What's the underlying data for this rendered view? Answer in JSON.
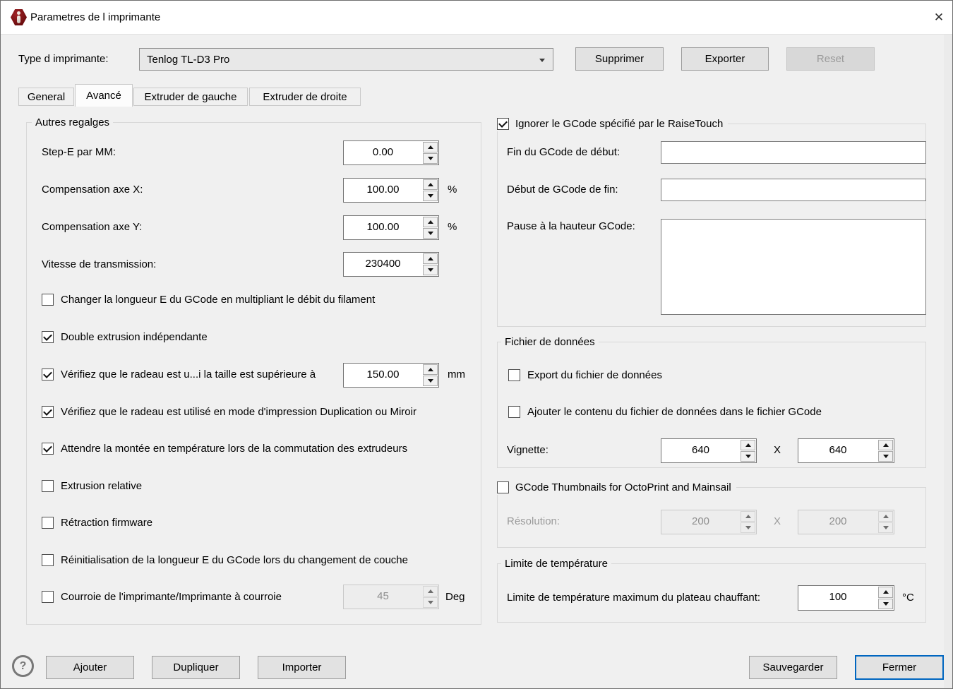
{
  "window": {
    "title": "Parametres de l imprimante"
  },
  "icons": {
    "close": "✕",
    "help": "?"
  },
  "header": {
    "printer_type_label": "Type d imprimante:",
    "printer_type_value": "Tenlog TL-D3 Pro",
    "supprimer": "Supprimer",
    "exporter": "Exporter",
    "reset": "Reset"
  },
  "tabs": [
    {
      "label": "General",
      "active": false
    },
    {
      "label": "Avancé",
      "active": true
    },
    {
      "label": "Extruder de gauche",
      "active": false
    },
    {
      "label": "Extruder de droite",
      "active": false
    }
  ],
  "left_panel": {
    "group_title": "Autres regalges",
    "fields": [
      {
        "label": "Step-E par MM:",
        "value": "0.00",
        "unit": ""
      },
      {
        "label": "Compensation axe X:",
        "value": "100.00",
        "unit": "%"
      },
      {
        "label": "Compensation axe Y:",
        "value": "100.00",
        "unit": "%"
      },
      {
        "label": "Vitesse de transmission:",
        "value": "230400",
        "unit": ""
      }
    ],
    "checkboxes": [
      {
        "label": "Changer la longueur E du GCode en multipliant le débit du filament",
        "checked": false
      },
      {
        "label": "Double extrusion indépendante",
        "checked": true
      },
      {
        "label": "Vérifiez que le radeau est u...i la taille est supérieure à",
        "checked": true,
        "value": "150.00",
        "unit": "mm"
      },
      {
        "label": "Vérifiez que le radeau est utilisé en mode d'impression Duplication ou Miroir",
        "checked": true
      },
      {
        "label": "Attendre la montée en température lors de la commutation des extrudeurs",
        "checked": true
      },
      {
        "label": "Extrusion relative",
        "checked": false
      },
      {
        "label": "Rétraction firmware",
        "checked": false
      },
      {
        "label": "Réinitialisation de la longueur E du GCode lors du changement de couche",
        "checked": false
      },
      {
        "label": "Courroie de l'imprimante/Imprimante à courroie",
        "checked": false,
        "value": "45",
        "unit": "Deg",
        "disabled": true
      }
    ]
  },
  "right_panel": {
    "gcode_group": {
      "title": "Ignorer le GCode spécifié par le RaiseTouch",
      "checked": true,
      "field1_label": "Fin du GCode de début:",
      "field2_label": "Début de GCode de fin:",
      "field3_label": "Pause à la hauteur GCode:",
      "field1_value": "",
      "field2_value": "",
      "field3_value": ""
    },
    "data_file_group": {
      "title": "Fichier de données",
      "checkboxes": [
        {
          "label": "Export du fichier de données",
          "checked": false
        },
        {
          "label": "Ajouter le contenu du fichier de données dans le fichier GCode",
          "checked": false
        }
      ],
      "vignette_label": "Vignette:",
      "vignette_width": "640",
      "vignette_height": "640",
      "separator": "X"
    },
    "thumbnails_group": {
      "title": "GCode Thumbnails for OctoPrint and Mainsail",
      "checked": false,
      "resolution_label": "Résolution:",
      "resolution_width": "200",
      "resolution_height": "200",
      "separator": "X"
    },
    "temp_group": {
      "title": "Limite de température",
      "label": "Limite de température maximum du plateau chauffant:",
      "value": "100",
      "unit": "°C"
    }
  },
  "footer": {
    "ajouter": "Ajouter",
    "dupliquer": "Dupliquer",
    "importer": "Importer",
    "sauvegarder": "Sauvegarder",
    "fermer": "Fermer"
  },
  "colors": {
    "accent_blue": "#0066c0",
    "app_icon_red": "#7a1012",
    "window_bg": "#f0f0f0",
    "disabled_text": "#9a9a9a"
  }
}
